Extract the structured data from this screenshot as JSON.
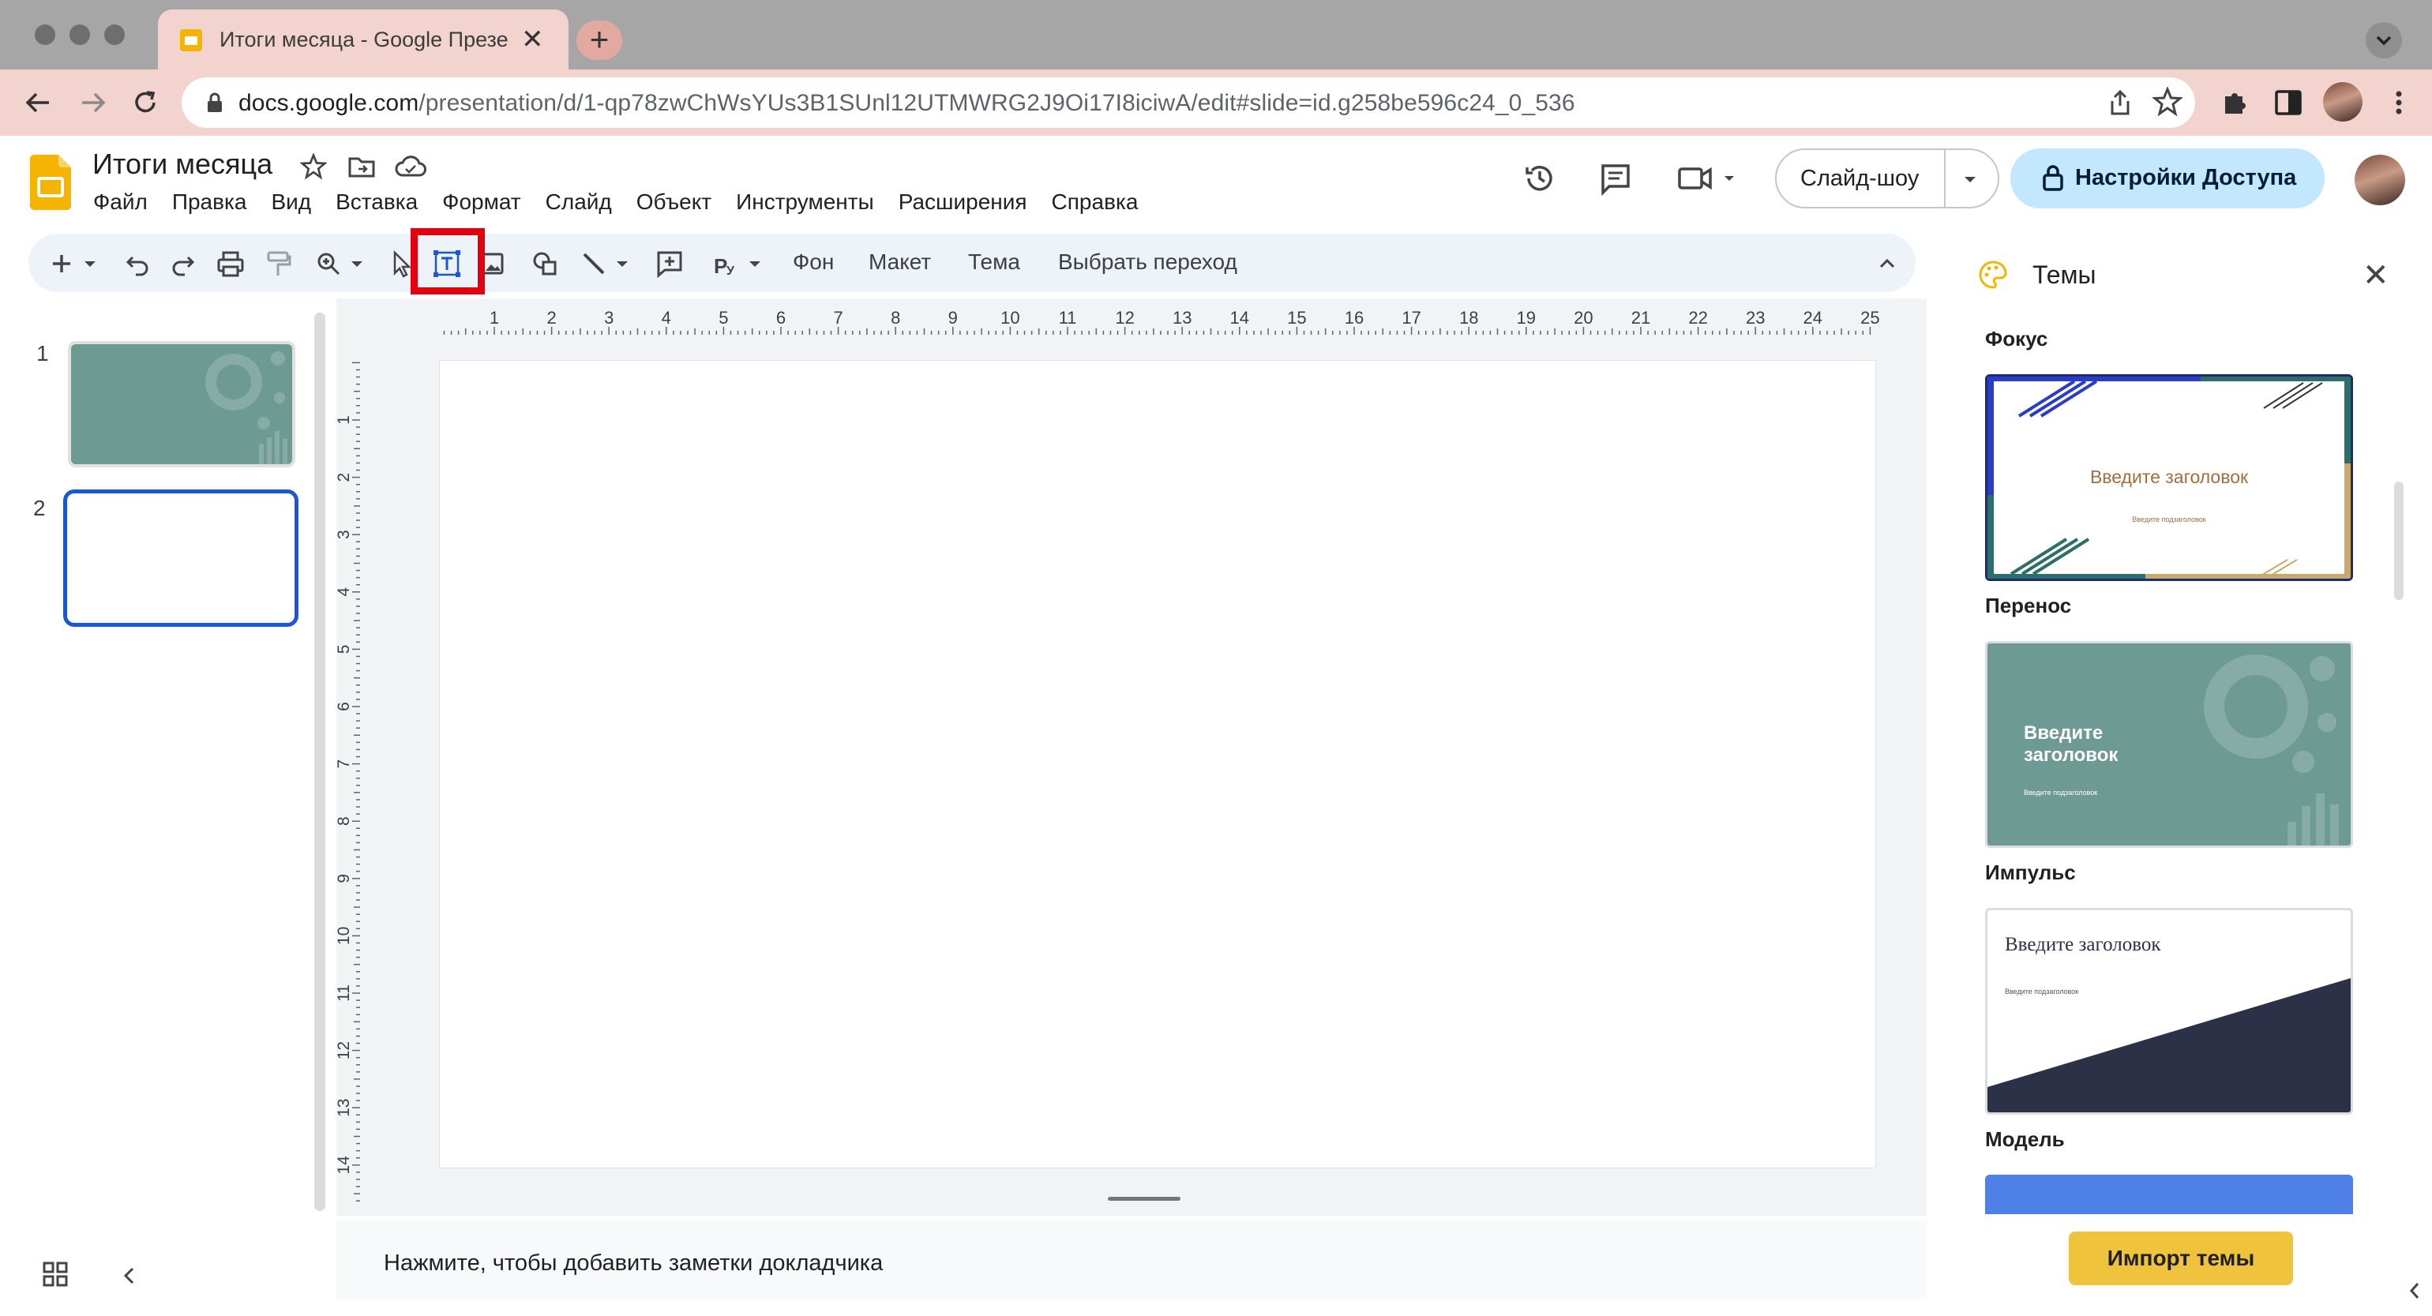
{
  "browser": {
    "tab_title": "Итоги месяца - Google Презе",
    "url_host": "docs.google.com",
    "url_path": "/presentation/d/1-qp78zwChWsYUs3B1SUnl12UTMWRG2J9Oi17I8iciwA/edit#slide=id.g258be596c24_0_536"
  },
  "doc": {
    "title": "Итоги месяца",
    "menus": [
      "Файл",
      "Правка",
      "Вид",
      "Вставка",
      "Формат",
      "Слайд",
      "Объект",
      "Инструменты",
      "Расширения",
      "Справка"
    ]
  },
  "header": {
    "slideshow_label": "Слайд-шоу",
    "share_label": "Настройки Доступа"
  },
  "toolbar": {
    "background_label": "Фон",
    "layout_label": "Макет",
    "theme_label": "Тема",
    "transition_label": "Выбрать переход"
  },
  "filmstrip": {
    "slides": [
      "1",
      "2"
    ]
  },
  "rulers": {
    "top": [
      "1",
      "2",
      "3",
      "4",
      "5",
      "6",
      "7",
      "8",
      "9",
      "10",
      "11",
      "12",
      "13",
      "14",
      "15",
      "16",
      "17",
      "18",
      "19",
      "20",
      "21",
      "22",
      "23",
      "24",
      "25"
    ],
    "left": [
      "1",
      "2",
      "3",
      "4",
      "5",
      "6",
      "7",
      "8",
      "9",
      "10",
      "11",
      "12",
      "13",
      "14"
    ]
  },
  "notes": {
    "placeholder": "Нажмите, чтобы добавить заметки докладчика"
  },
  "themes_panel": {
    "title": "Темы",
    "themes": [
      {
        "name": "Фокус",
        "preview_title": "Введите заголовок",
        "preview_subtitle": "Введите подзаголовок"
      },
      {
        "name": "Перенос",
        "preview_title": "Введите заголовок",
        "preview_subtitle": "Введите подзаголовок"
      },
      {
        "name": "Импульс",
        "preview_title": "Введите заголовок",
        "preview_subtitle": "Введите подзаголовок"
      },
      {
        "name": "Модель"
      }
    ],
    "import_label": "Импорт темы"
  },
  "colors": {
    "accent_highlight": "#e3000f",
    "share_button": "#c2e7ff",
    "import_button": "#f0c33d",
    "selected_slide_border": "#1a57d6",
    "teal_theme": "#6d9a92"
  }
}
